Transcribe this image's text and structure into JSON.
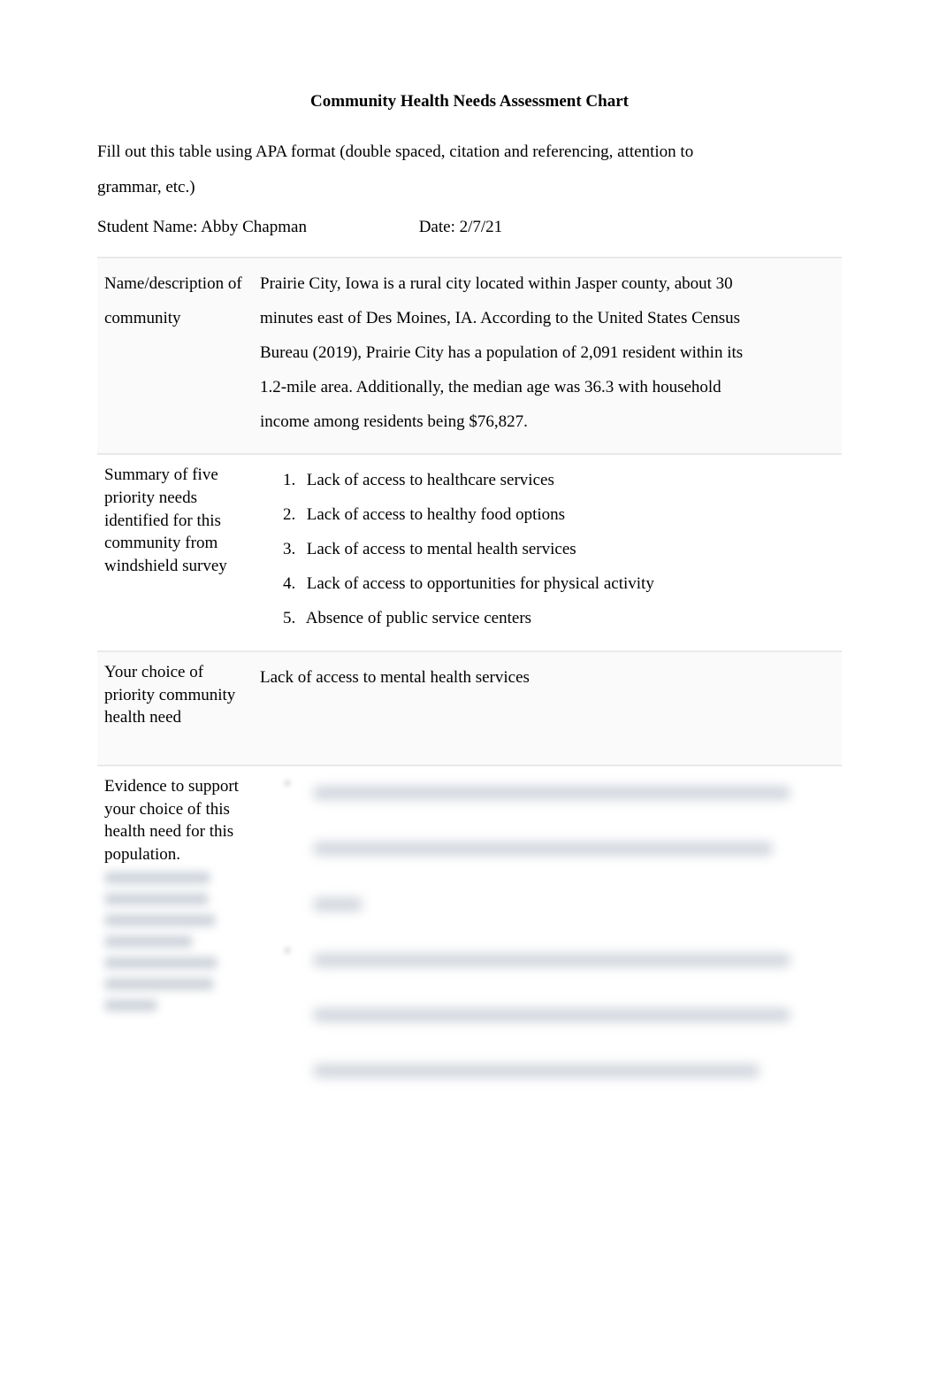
{
  "title": "Community Health Needs Assessment Chart",
  "intro_line1": "Fill out this table using APA format (double spaced, citation and referencing, attention to",
  "intro_line2": "grammar, etc.)",
  "student_name_label": "Student Name:",
  "student_name_value": "Abby Chapman",
  "date_label": "Date:",
  "date_value": "2/7/21",
  "rows": {
    "r1": {
      "label": "Name/description of community",
      "p1": "Prairie City, Iowa is a rural city located within Jasper county, about 30",
      "p2": "minutes east of Des Moines, IA. According to the United States Census",
      "p3": "Bureau (2019), Prairie City has a population of 2,091 resident within its",
      "p4": "1.2-mile area. Additionally, the median age was 36.3 with household",
      "p5": "income among residents being $76,827."
    },
    "r2": {
      "label": "Summary of five priority needs identified for this community from windshield survey",
      "items": {
        "i1": "Lack of access to healthcare services",
        "i2": "Lack of access to healthy food options",
        "i3": "Lack of access to mental health services",
        "i4": "Lack of access to opportunities for physical activity",
        "i5": "Absence of public service centers"
      }
    },
    "r3": {
      "label": "Your choice of priority community health need",
      "value": "Lack of access to mental health services"
    },
    "r4": {
      "label": "Evidence to support your choice of this health need for this population."
    }
  },
  "list_numbers": {
    "n1": "1.",
    "n2": "2.",
    "n3": "3.",
    "n4": "4.",
    "n5": "5."
  }
}
